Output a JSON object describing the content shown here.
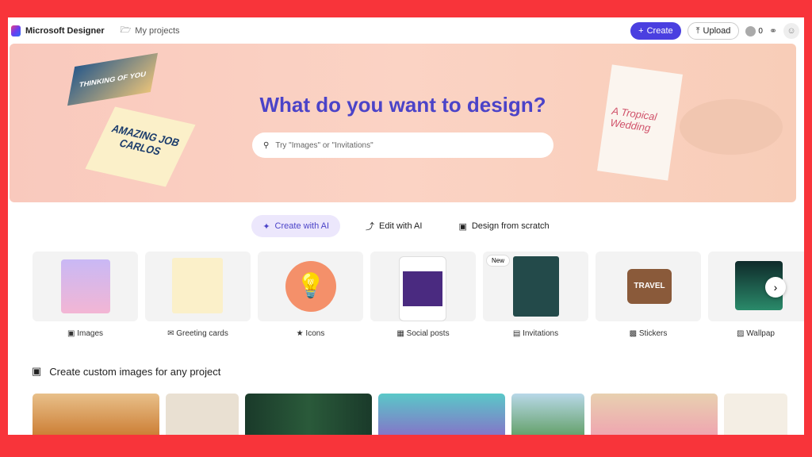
{
  "header": {
    "brand": "Microsoft Designer",
    "my_projects": "My projects",
    "create": "Create",
    "upload": "Upload",
    "credits": "0"
  },
  "hero": {
    "title": "What do you want to design?",
    "search_placeholder": "Try \"Images\" or \"Invitations\"",
    "card1": "THINKING OF YOU",
    "card2": "AMAZING JOB CARLOS",
    "invite": "A Tropical Wedding"
  },
  "tabs": [
    {
      "label": "Create with AI",
      "active": true
    },
    {
      "label": "Edit with AI"
    },
    {
      "label": "Design from scratch"
    }
  ],
  "categories": [
    {
      "label": "Images"
    },
    {
      "label": "Greeting cards"
    },
    {
      "label": "Icons"
    },
    {
      "label": "Social posts"
    },
    {
      "label": "Invitations",
      "badge": "New"
    },
    {
      "label": "Stickers"
    },
    {
      "label": "Wallpap"
    }
  ],
  "section": {
    "title": "Create custom images for any project"
  }
}
